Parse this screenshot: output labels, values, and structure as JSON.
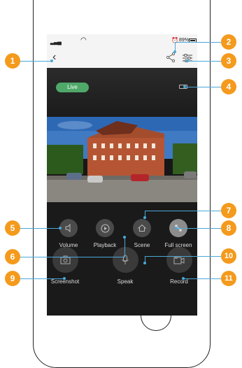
{
  "status_bar": {
    "battery": "89%"
  },
  "stream": {
    "live_label": "Live"
  },
  "controls": {
    "volume": "Volume",
    "playback": "Playback",
    "scene": "Scene",
    "full_screen": "Full screen",
    "screenshot": "Screenshot",
    "speak": "Speak",
    "record": "Record"
  },
  "callouts": [
    "1",
    "2",
    "3",
    "4",
    "5",
    "6",
    "7",
    "8",
    "9",
    "10",
    "11"
  ],
  "colors": {
    "accent_orange": "#f49a1c",
    "live_green": "#4fa86a",
    "leader_blue": "#4aa8d8"
  },
  "icons": [
    "back-icon",
    "share-icon",
    "settings-icon",
    "quality-icon",
    "volume-icon",
    "playback-icon",
    "scene-icon",
    "fullscreen-icon",
    "camera-icon",
    "mic-icon",
    "video-icon"
  ]
}
